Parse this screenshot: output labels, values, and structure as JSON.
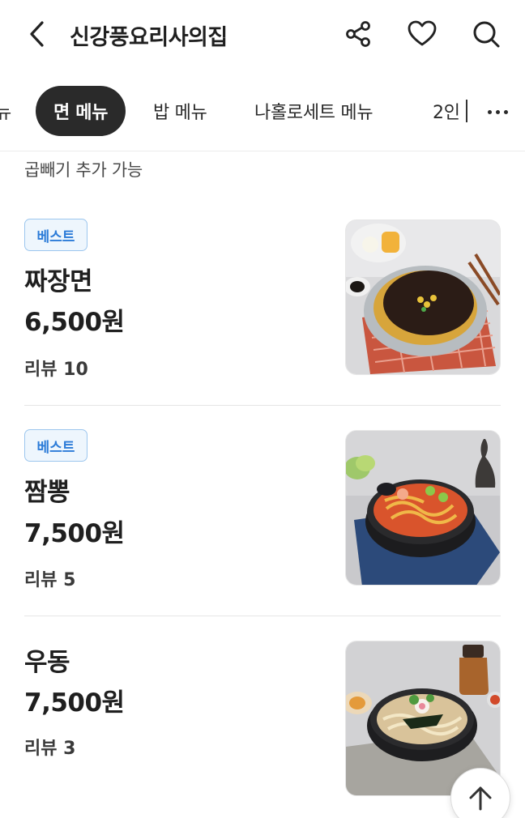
{
  "header": {
    "title": "신강풍요리사의집",
    "icons": [
      "back-arrow-icon",
      "share-icon",
      "heart-icon",
      "search-icon"
    ]
  },
  "tabs": {
    "partial_label": "뉴",
    "items": [
      "면 메뉴",
      "밥 메뉴",
      "나홀로세트 메뉴",
      "2인"
    ],
    "active_index": 0
  },
  "section": {
    "note": "곱빼기 추가 가능"
  },
  "menu": [
    {
      "badge": "베스트",
      "name": "짜장면",
      "price": "6,500원",
      "review": "리뷰 10",
      "image": "jjajangmyeon"
    },
    {
      "badge": "베스트",
      "name": "짬뽕",
      "price": "7,500원",
      "review": "리뷰 5",
      "image": "jjamppong"
    },
    {
      "badge": "",
      "name": "우동",
      "price": "7,500원",
      "review": "리뷰 3",
      "image": "udon"
    }
  ],
  "colors": {
    "active_tab_bg": "#2a2a2a",
    "badge_text": "#2b7bd8",
    "badge_bg": "#eef6fd",
    "badge_border": "#9cc6ee"
  }
}
